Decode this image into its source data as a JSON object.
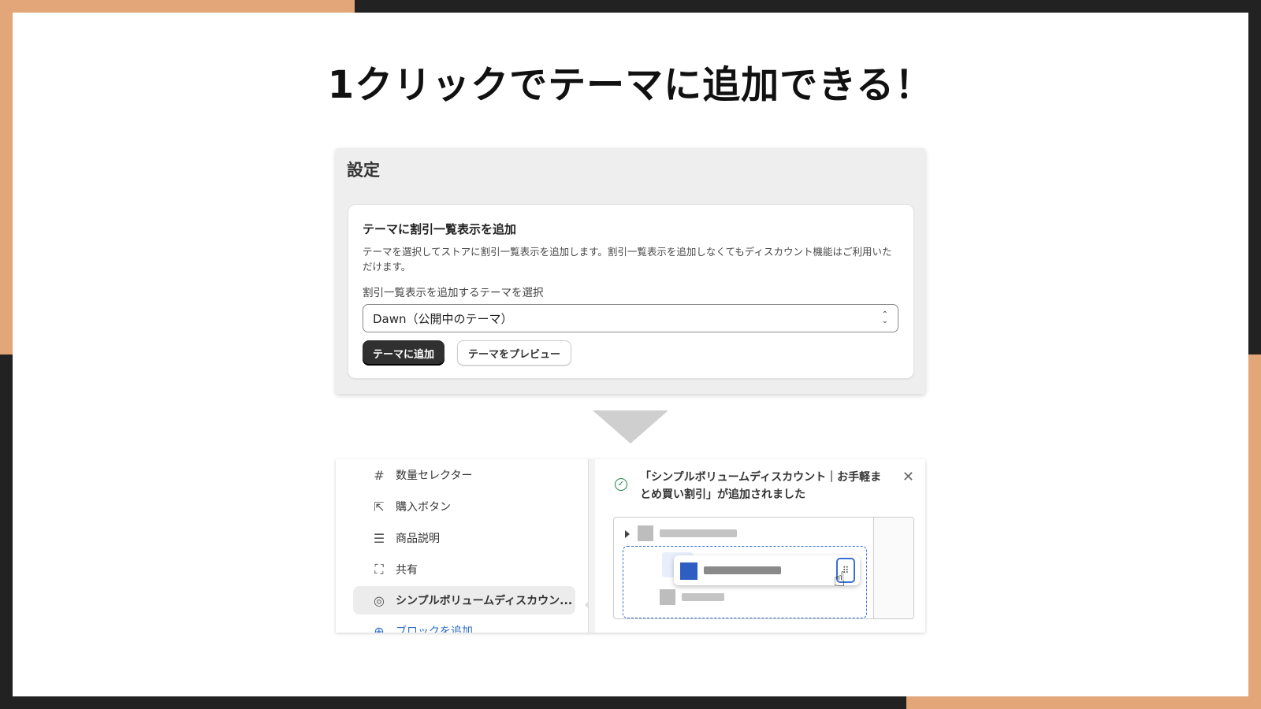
{
  "headline": "1クリックでテーマに追加できる！",
  "settings": {
    "title": "設定",
    "card_title": "テーマに割引一覧表示を追加",
    "description": "テーマを選択してストアに割引一覧表示を追加します。割引一覧表示を追加しなくてもディスカウント機能はご利用いただけます。",
    "select_label": "割引一覧表示を追加するテーマを選択",
    "select_value": "Dawn（公開中のテーマ）",
    "add_button": "テーマに追加",
    "preview_button": "テーマをプレビュー"
  },
  "editor": {
    "blocks": [
      {
        "label": "数量セレクター",
        "icon": "hash-icon",
        "glyph": "#"
      },
      {
        "label": "購入ボタン",
        "icon": "cursor-click-icon",
        "glyph": "⇱"
      },
      {
        "label": "商品説明",
        "icon": "text-lines-icon",
        "glyph": "☰"
      },
      {
        "label": "共有",
        "icon": "share-frame-icon",
        "glyph": "⛶"
      },
      {
        "label": "シンプルボリュームディスカウン...",
        "icon": "app-block-icon",
        "glyph": "◎"
      }
    ],
    "add_block": "ブロックを追加",
    "toast_message": "「シンプルボリュームディスカウント｜お手軽まとめ買い割引」が追加されました"
  },
  "colors": {
    "accent": "#E3A678",
    "frame": "#222222",
    "primary_button": "#303030",
    "link": "#2c6ecb",
    "drag_blue": "#2f5ec2"
  }
}
